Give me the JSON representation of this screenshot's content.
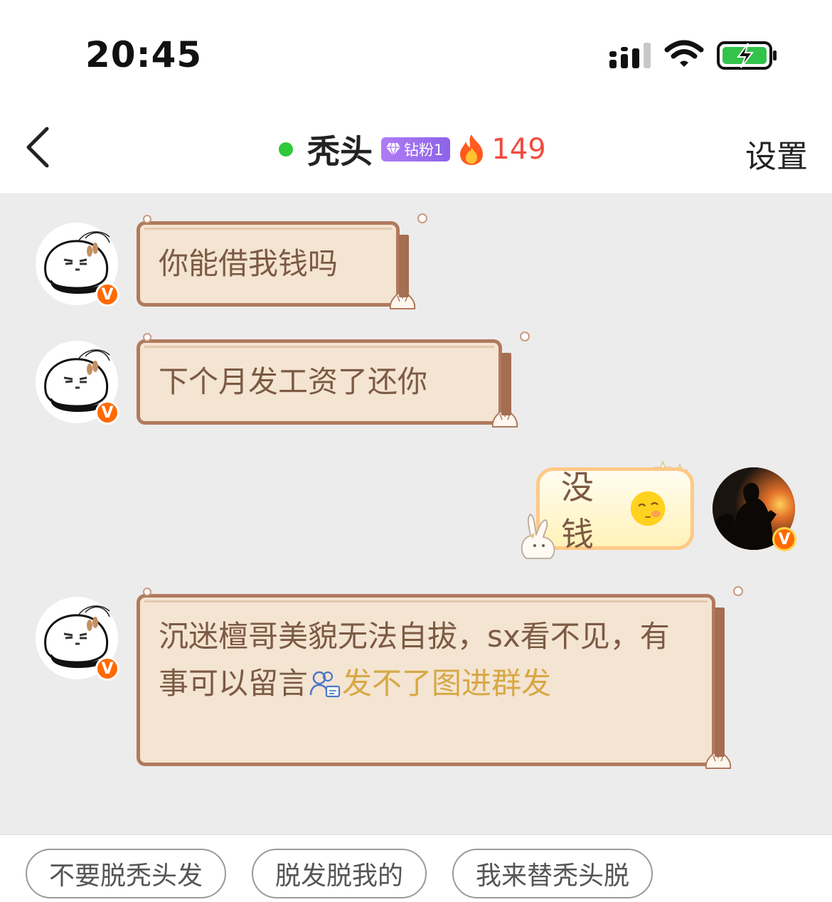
{
  "status_bar": {
    "time": "20:45"
  },
  "header": {
    "title": "秃头",
    "fan_badge": "钻粉1",
    "fire_count": "149",
    "settings_label": "设置"
  },
  "messages": [
    {
      "sender": "other",
      "text": "你能借我钱吗"
    },
    {
      "sender": "other",
      "text": "下个月发工资了还你"
    },
    {
      "sender": "me",
      "text": "没钱"
    },
    {
      "sender": "other",
      "text": "沉迷檀哥美貌无法自拔，sx看不见，有事可以留言",
      "link_text": "发不了图进群发"
    }
  ],
  "badges": {
    "v_label": "V"
  },
  "quick_replies": [
    "不要脱秃头发",
    "脱发脱我的",
    "我来替秃头脱"
  ],
  "colors": {
    "online": "#2fc93a",
    "fire_count": "#f14b3e",
    "bubble_border": "#b07a5e",
    "bubble_fill": "#f4e4d2",
    "bubble_text": "#7c5a44",
    "link_text": "#d7a845",
    "v_badge": "#ff6a00"
  }
}
